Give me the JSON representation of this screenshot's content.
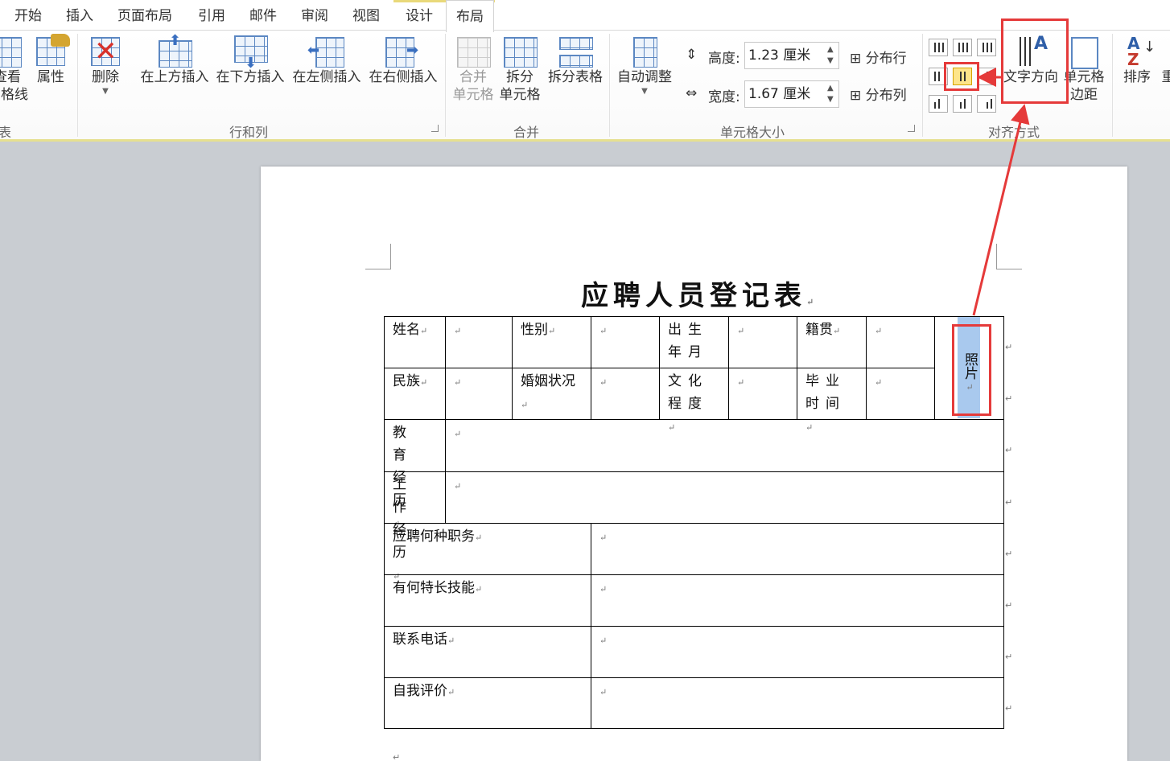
{
  "tabs": [
    "开始",
    "插入",
    "页面布局",
    "引用",
    "邮件",
    "审阅",
    "视图",
    "设计",
    "布局"
  ],
  "active_tab": "布局",
  "ribbon": {
    "table_group": {
      "view_gridlines": [
        "查看",
        "网格线"
      ],
      "view_gridlines_cut": [
        "查看",
        "网格线"
      ],
      "properties": "属性",
      "label": "表"
    },
    "rows_cols": {
      "delete": "删除",
      "insert_above": "在上方插入",
      "insert_below": "在下方插入",
      "insert_left": "在左侧插入",
      "insert_right": "在右侧插入",
      "label": "行和列"
    },
    "merge": {
      "merge_cells": [
        "合并",
        "单元格"
      ],
      "split_cells": [
        "拆分",
        "单元格"
      ],
      "split_table": "拆分表格",
      "label": "合并"
    },
    "cell_size": {
      "autofit": "自动调整",
      "height_label": "高度:",
      "height_value": "1.23 厘米",
      "width_label": "宽度:",
      "width_value": "1.67 厘米",
      "distribute_rows": "分布行",
      "distribute_cols": "分布列",
      "label": "单元格大小"
    },
    "alignment": {
      "text_direction": "文字方向",
      "cell_margins": [
        "单元格",
        "边距"
      ],
      "label": "对齐方式"
    },
    "data": {
      "sort": "排序",
      "more": "重"
    }
  },
  "document": {
    "title": "应聘人员登记表",
    "rows": [
      {
        "c1": "姓名",
        "c3": "性别",
        "c5": "出生年月",
        "c7": "籍贯"
      },
      {
        "c1": "民族",
        "c3": "婚姻状况",
        "c5": "文化程度",
        "c7": "毕业时间"
      }
    ],
    "photo": "照片",
    "edu": "教育经历",
    "work": "工作经历",
    "position": "应聘何种职务",
    "skills": "有何特长技能",
    "phone": "联系电话",
    "self_eval": "自我评价",
    "para_mark": "↵"
  },
  "colors": {
    "highlight": "#a9c9ee",
    "annotation": "#e53a3a",
    "accent_strip": "#e6e090"
  }
}
